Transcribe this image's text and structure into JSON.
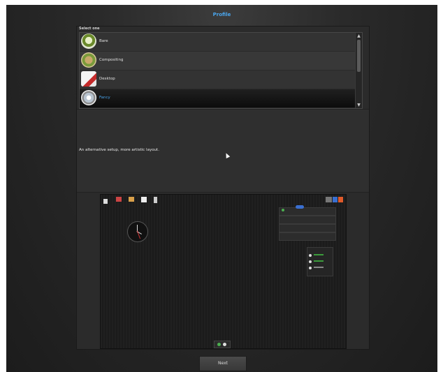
{
  "window": {
    "title": "Profile"
  },
  "select_label": "Select one",
  "profiles": [
    {
      "label": "Bare",
      "icon": "bare-icon",
      "selected": false
    },
    {
      "label": "Compositing",
      "icon": "compositing-icon",
      "selected": false
    },
    {
      "label": "Desktop",
      "icon": "desktop-icon",
      "selected": false
    },
    {
      "label": "Fancy",
      "icon": "fancy-icon",
      "selected": true
    }
  ],
  "description": "An alternative setup, more artistic layout.",
  "buttons": {
    "next": "Next"
  },
  "colors": {
    "accent": "#4aa6ee",
    "selected_row": "#111111",
    "background": "#2a2a2a"
  }
}
